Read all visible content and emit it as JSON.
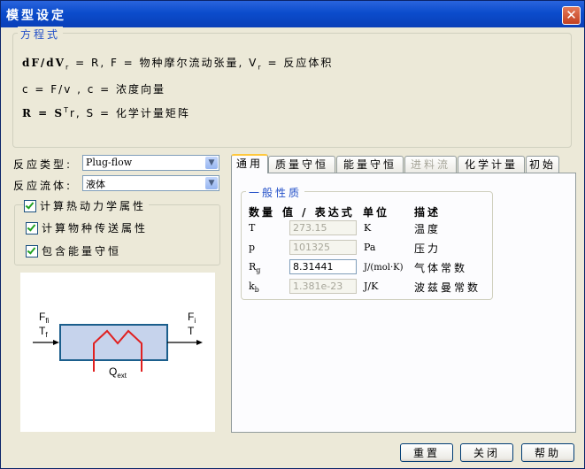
{
  "window": {
    "title": "模型设定",
    "close_glyph": "✕"
  },
  "equations": {
    "legend": "方程式",
    "eq1_lhs": "dF/dV",
    "eq1_lhs_sub": "r",
    "eq1_mid": " = R, F = 物种摩尔流动张量, V",
    "eq1_mid_sub": "r",
    "eq1_rhs": " = 反应体积",
    "eq2": "c = F/v , c = 浓度向量",
    "eq3_lhs": "R = S",
    "eq3_sup": "T",
    "eq3_rhs": "r, S = 化学计量矩阵"
  },
  "reaction_type": {
    "label": "反应类型:",
    "value": "Plug-flow"
  },
  "reaction_fluid": {
    "label": "反应流体:",
    "value": "液体"
  },
  "thermo": {
    "label": "计算热动力学属性",
    "transport_label": "计算物种传送属性",
    "energy_label": "包含能量守恒"
  },
  "diagram": {
    "inlet_flow": "F",
    "inlet_flow_sub": "fi",
    "inlet_temp": "T",
    "inlet_temp_sub": "f",
    "outlet_flow": "F",
    "outlet_flow_sub": "i",
    "outlet_temp": "T",
    "heat": "Q",
    "heat_sub": "ext"
  },
  "tabs": [
    "通用",
    "质量守恒",
    "能量守恒",
    "进料流",
    "化学计量",
    "初始"
  ],
  "general": {
    "legend": "一般性质",
    "headers": {
      "qty": "数量",
      "value": "值 / 表达式",
      "unit": "单位",
      "desc": "描述"
    },
    "rows": [
      {
        "sym": "T",
        "sub": "",
        "value": "273.15",
        "unit": "K",
        "desc": "温度"
      },
      {
        "sym": "p",
        "sub": "",
        "value": "101325",
        "unit": "Pa",
        "desc": "压力"
      },
      {
        "sym": "R",
        "sub": "g",
        "value": "8.31441",
        "unit": "J/(mol·K)",
        "desc": "气体常数"
      },
      {
        "sym": "k",
        "sub": "b",
        "value": "1.381e-23",
        "unit": "J/K",
        "desc": "波兹曼常数"
      }
    ]
  },
  "buttons": {
    "reset": "重置",
    "close": "关闭",
    "help": "帮助"
  },
  "colors": {
    "title_bar": "#0b4ccc",
    "legend_text": "#2350c8",
    "reactor_fill": "#c6d3ec",
    "heater": "#e02020"
  }
}
